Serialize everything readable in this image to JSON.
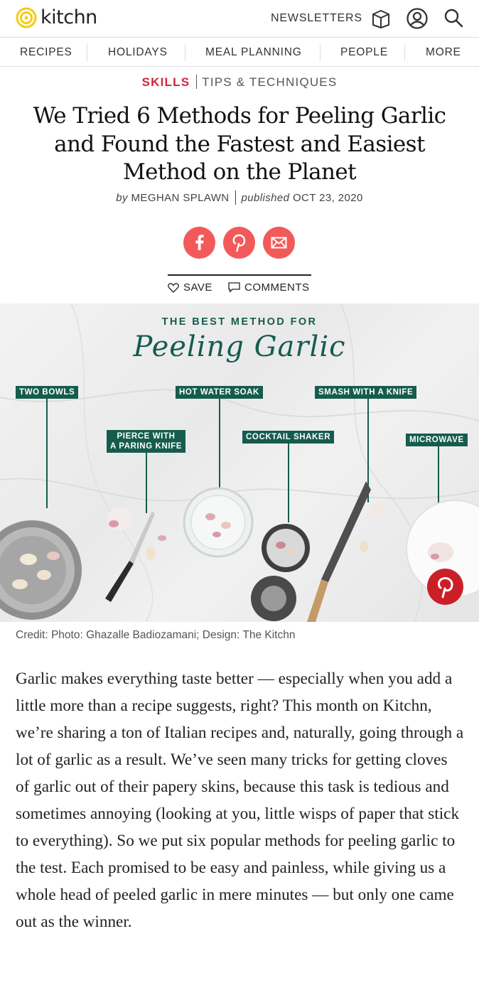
{
  "header": {
    "logo_text": "kitchn",
    "newsletters_label": "NEWSLETTERS",
    "icons": [
      "box-icon",
      "user-icon",
      "search-icon"
    ]
  },
  "nav": {
    "items": [
      {
        "label": "RECIPES"
      },
      {
        "label": "HOLIDAYS"
      },
      {
        "label": "MEAL PLANNING"
      },
      {
        "label": "PEOPLE"
      },
      {
        "label": "MORE"
      }
    ]
  },
  "article": {
    "category_primary": "SKILLS",
    "category_secondary": "TIPS & TECHNIQUES",
    "title": "We Tried 6 Methods for Peeling Garlic and Found the Fastest and Easiest Method on the Planet",
    "by_prefix": "by",
    "author": "MEGHAN SPLAWN",
    "published_prefix": "published",
    "published_date": "OCT 23, 2020",
    "share_icons": [
      "facebook-icon",
      "pinterest-icon",
      "email-icon"
    ],
    "save_label": "SAVE",
    "comments_label": "COMMENTS",
    "image": {
      "kicker": "THE BEST METHOD FOR",
      "script_title": "Peeling Garlic",
      "labels": {
        "two_bowls": "TWO BOWLS",
        "hot_water": "HOT WATER SOAK",
        "smash": "SMASH WITH A KNIFE",
        "pierce_1": "PIERCE WITH",
        "pierce_2": "A PARING KNIFE",
        "cocktail": "COCKTAIL SHAKER",
        "microwave": "MICROWAVE"
      }
    },
    "credit": "Credit: Photo: Ghazalle Badiozamani; Design: The Kitchn",
    "body": "Garlic makes everything taste better — especially when you add a little more than a recipe suggests, right? This month on Kitchn, we’re sharing a ton of Italian recipes and, naturally, going through a lot of garlic as a result. We’ve seen many tricks for getting cloves of garlic out of their papery skins, because this task is tedious and sometimes annoying (looking at you, little wisps of paper that stick to everything). So we put six popular methods for peeling garlic to the test. Each promised to be easy and painless, while giving us a whole head of peeled garlic in mere minutes — but only one came out as the winner."
  },
  "colors": {
    "brand_yellow": "#f5cb12",
    "category_red": "#d6243b",
    "share_red": "#f25a5a",
    "infographic_green": "#155c4f",
    "pinterest_red": "#cb1f27"
  }
}
